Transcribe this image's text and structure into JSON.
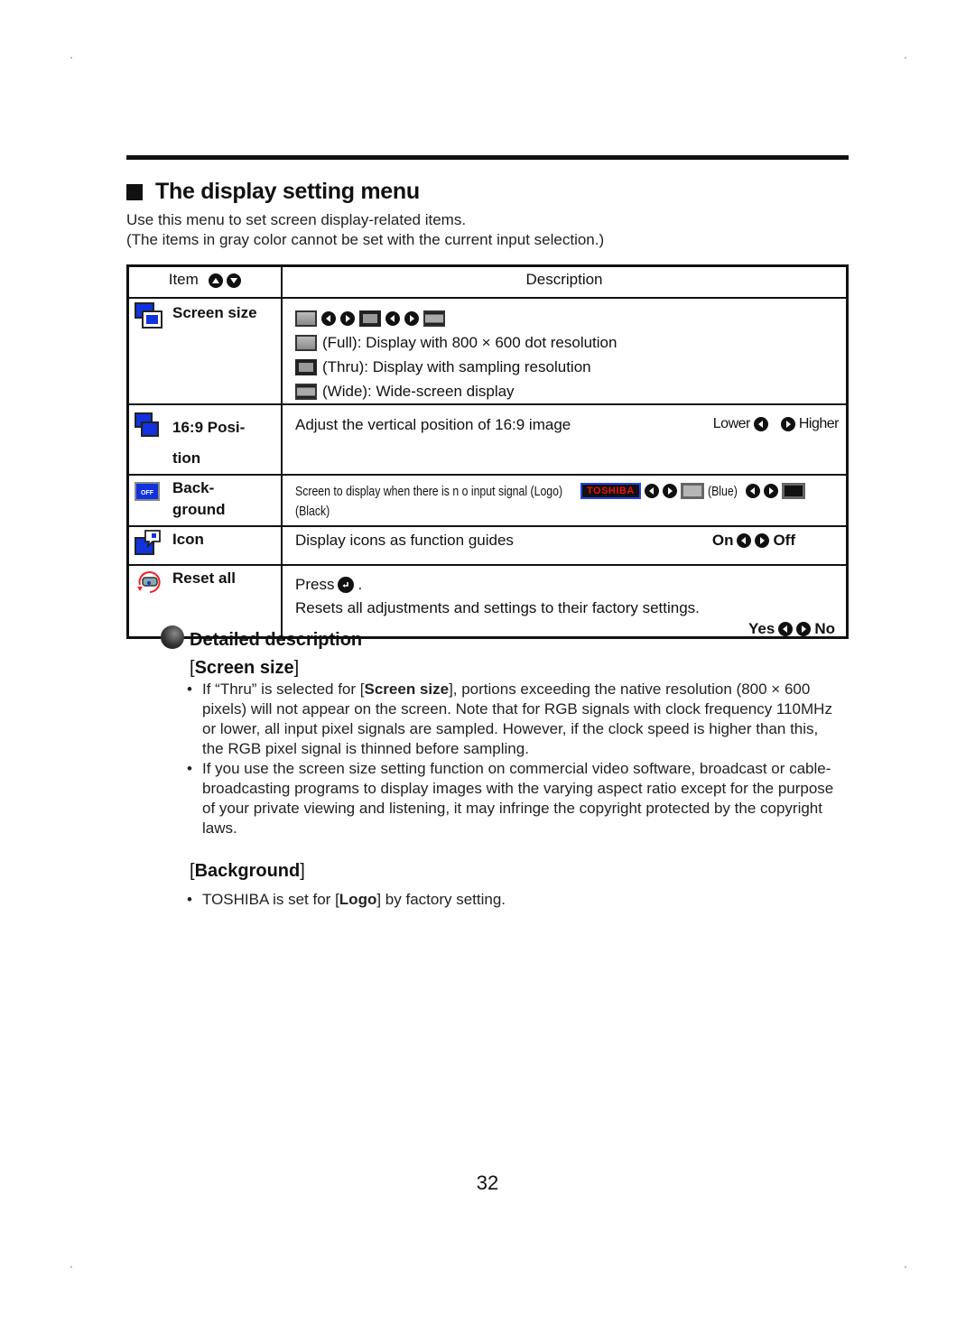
{
  "page": {
    "title": "The display setting menu",
    "intro": [
      "Use this menu to set screen display-related items.",
      "(The items in gray color cannot be set with the current input selection.)"
    ],
    "page_number": "32"
  },
  "table": {
    "header": {
      "item": "Item",
      "description": "Description"
    },
    "rows": [
      {
        "item": "Screen size",
        "icon": "screen-size-icon",
        "options": [
          "Full",
          "Thru",
          "Wide"
        ],
        "lines": [
          "(Full): Display with 800 × 600 dot resolution",
          "(Thru): Display with sampling resolution",
          "(Wide): Wide-screen display"
        ]
      },
      {
        "item": "16:9 Posi-",
        "item2": "tion",
        "icon": "position-icon",
        "description": "Adjust the vertical position of 16:9 image",
        "left_option": "Lower",
        "right_option": "Higher"
      },
      {
        "item": "Back-",
        "item2": "ground",
        "icon": "background-off-icon",
        "description": "Screen to display when there is n o input signal (Logo)",
        "logo_text": "TOSHIBA",
        "opt_blue": "(Blue)",
        "opt_black": "(Black)",
        "colors": {
          "blue": "#b5b5b5",
          "black": "#111111",
          "logo_text": "#ee1111",
          "logo_border": "#2244ee"
        }
      },
      {
        "item": "Icon",
        "icon": "icon-guide-icon",
        "description": "Display icons as function guides",
        "left_option": "On",
        "right_option": "Off"
      },
      {
        "item": "Reset all",
        "icon": "reset-icon",
        "press": "Press",
        "press_end": ".",
        "description": "Resets all adjustments and settings to their factory settings.",
        "left_option": "Yes",
        "right_option": "No"
      }
    ]
  },
  "detail": {
    "heading": "Detailed description",
    "sections": [
      {
        "title": "Screen size",
        "bullets": [
          {
            "pre": "If “Thru” is selected for [",
            "bold": "Screen size",
            "post": "], portions exceeding the native resolution (800 × 600 pixels) will not appear on the screen. Note that for RGB signals with clock frequency 110MHz or lower, all input pixel signals are sampled. However, if the clock speed is higher than this, the RGB pixel signal is thinned before sampling."
          },
          {
            "pre": "If you use the screen size setting function on commercial video software, broadcast or cable-broadcasting programs to display images with the varying aspect ratio except for the purpose of your private viewing and listening, it may infringe the copyright protected by the copyright laws.",
            "bold": "",
            "post": ""
          }
        ]
      },
      {
        "title": "Background",
        "bullets": [
          {
            "pre": "TOSHIBA is set for [",
            "bold": "Logo",
            "post": "] by factory setting."
          }
        ]
      }
    ]
  }
}
